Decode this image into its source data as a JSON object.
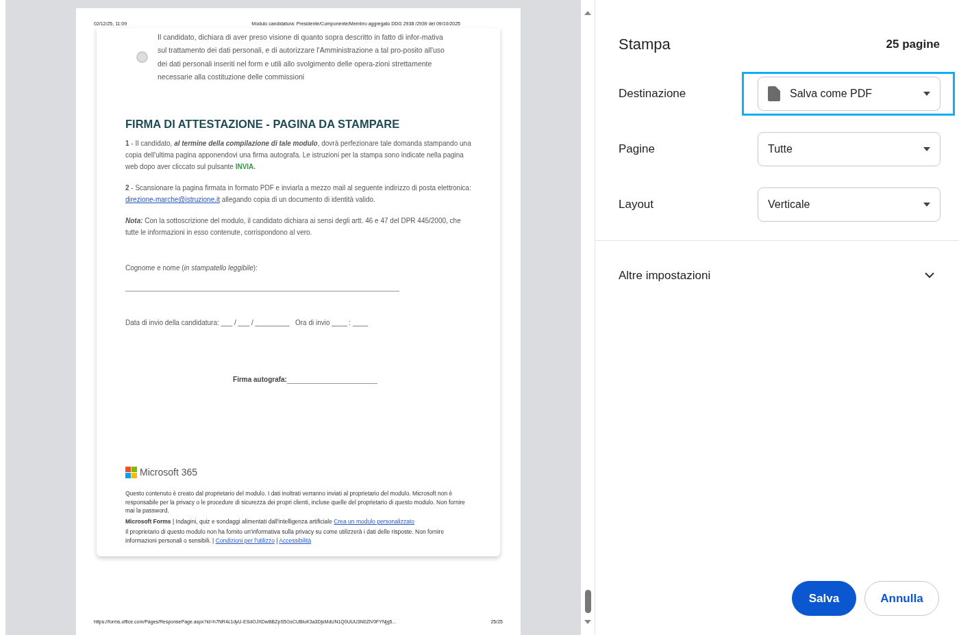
{
  "preview": {
    "page": {
      "header_date": "02/12/25, 11:09",
      "header_title": "Modulo candidatura: Presidente/Componente/Membro aggregato DDG 2938 /2939 del 09/10/2025",
      "consent": {
        "text": "Il candidato, dichiara di aver preso visione di quanto sopra descritto in fatto di infor-mativa sul trattamento dei dati personali, e di autorizzare l'Amministrazione a tal pro-posito all'uso dei dati personali inseriti nel form e utili allo svolgimento delle opera-zioni strettamente necessarie alla costituzione delle commissioni",
        "selected": false
      },
      "section_title": "FIRMA DI ATTESTAZIONE - PAGINA DA STAMPARE",
      "paragraphs": [
        [
          {
            "kind": "text",
            "text": "**1** - Il candidato, "
          },
          {
            "kind": "emph",
            "text": "al termine della compilazione di tale modulo"
          },
          {
            "kind": "text",
            "text": ", dovrà perfezionare tale domanda stampando una copia dell'ultima pagina apponendovi una firma autografa. Le istruzioni per la stampa sono indicate nella pagina web dopo aver cliccato sul pulsante "
          },
          {
            "kind": "accent",
            "text": "INVIA."
          }
        ],
        [
          {
            "kind": "text",
            "text": "**2** - Scansionare la pagina firmata in formato PDF e inviarla a mezzo mail al seguente indirizzo di posta elettronica: "
          },
          {
            "kind": "link",
            "text": "direzione-marche@istruzione.it"
          },
          {
            "kind": "text",
            "text": " allegando copia di un documento di identità valido."
          }
        ],
        [
          {
            "kind": "emph",
            "text": "Nota:"
          },
          {
            "kind": "text",
            "text": " Con la sottoscrizione del modulo, il candidato dichiara ai sensi degli artt. 46 e 47 del DPR 445/2000, che tutte le informazioni in esso contenute, corrispondono al vero."
          }
        ]
      ],
      "name_label": "Cognome e nome (*in stampatello leggibile*):",
      "date_label": "Data di invio della candidatura: ___ / ___ / _________   Ora di invio ____ : ____",
      "signature_label": "Firma autografa:",
      "brand": "Microsoft 365",
      "disclaimer": "Questo contenuto è creato dal proprietario del modulo. I dati inoltrati verranno inviati al proprietario del modulo. Microsoft non è responsabile per la privacy o le procedure di sicurezza dei propri clienti, incluse quelle del proprietario di questo modulo. Non fornire mai la password.",
      "forms_line": [
        {
          "kind": "text",
          "text": "**Microsoft Forms** | Indagini, quiz e sondaggi alimentati dall'intelligenza artificiale "
        },
        {
          "kind": "link",
          "text": "Crea un modulo personalizzato"
        }
      ],
      "privacy_line": [
        {
          "kind": "text",
          "text": "Il proprietario di questo modulo non ha fornito un'informativa sulla privacy su come utilizzerà i dati delle risposte. Non fornire informazioni personali o sensibili. | "
        },
        {
          "kind": "link",
          "text": "Condizioni per l'utilizzo"
        },
        {
          "kind": "text",
          "text": " | "
        },
        {
          "kind": "link",
          "text": "Accessibilità"
        }
      ],
      "footer_url": "https://forms.office.com/Pages/ResponsePage.aspx?id=h7NR4c1dyU-ESdOJXDwBBZpS5GsCUBluK3a3DjsMdUN1Q0UUU3N0ZlV0FYNjg5...",
      "footer_page": "25/25"
    }
  },
  "panel": {
    "title": "Stampa",
    "page_count": "25 pagine",
    "settings": [
      {
        "label": "Destinazione",
        "value": "Salva come PDF",
        "highlighted": true
      },
      {
        "label": "Pagine",
        "value": "Tutte",
        "highlighted": false
      },
      {
        "label": "Layout",
        "value": "Verticale",
        "highlighted": false
      }
    ],
    "more": {
      "label": "Altre impostazioni",
      "expanded": false
    },
    "buttons": [
      {
        "label": "Salva",
        "kind": "primary"
      },
      {
        "label": "Annulla",
        "kind": "secondary"
      }
    ]
  }
}
